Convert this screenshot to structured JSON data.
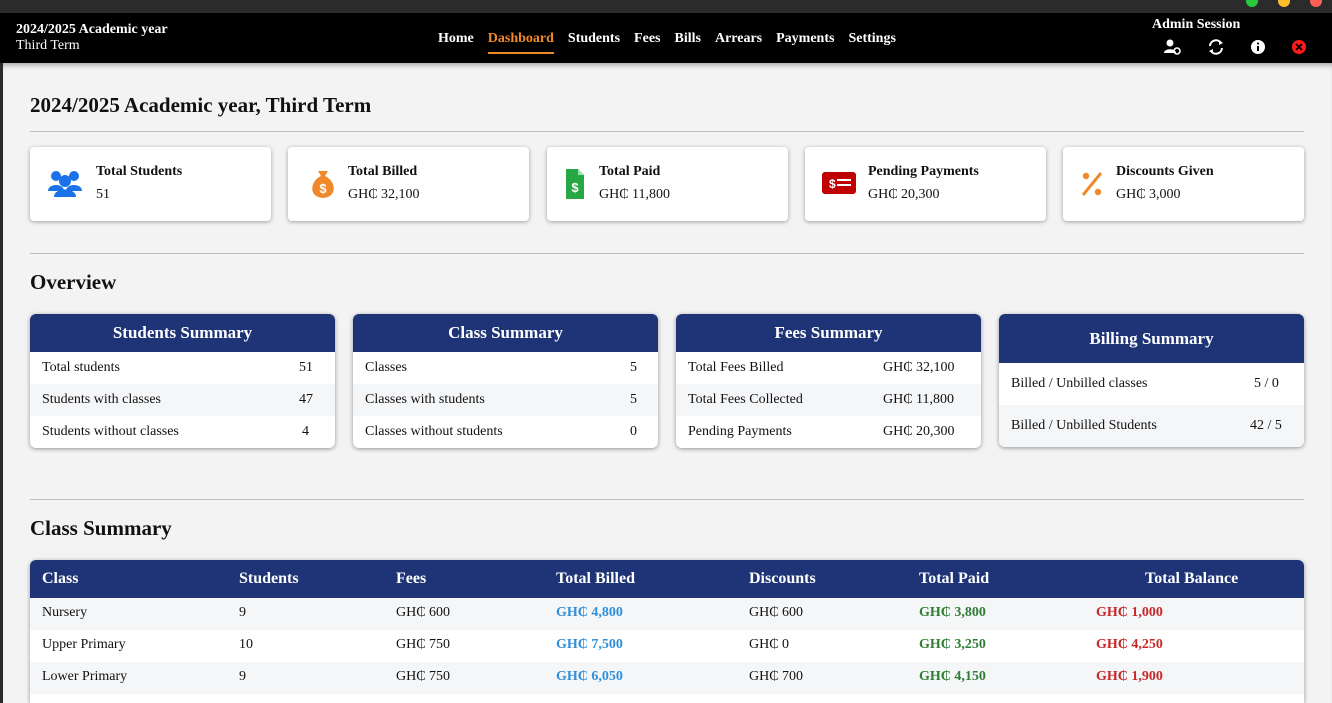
{
  "colors": {
    "nav_bg": "#000000",
    "accent_active": "#f0892a",
    "card_header": "#1f3476",
    "billed": "#2f8fd8",
    "paid": "#2e7d32",
    "balance": "#c62828"
  },
  "nav": {
    "title_line1": "2024/2025 Academic year",
    "title_line2": "Third Term",
    "links": [
      "Home",
      "Dashboard",
      "Students",
      "Fees",
      "Bills",
      "Arrears",
      "Payments",
      "Settings"
    ],
    "active": "Dashboard",
    "session_label": "Admin Session",
    "icons": [
      "user-settings-icon",
      "refresh-icon",
      "info-icon",
      "close-session-icon"
    ]
  },
  "page_title": "2024/2025 Academic year, Third Term",
  "stats": [
    {
      "label": "Total Students",
      "value": "51",
      "icon": "users-icon",
      "color": "#1a73e8"
    },
    {
      "label": "Total Billed",
      "value": "GH₵ 32,100",
      "icon": "money-bag-icon",
      "color": "#f0892a"
    },
    {
      "label": "Total Paid",
      "value": "GH₵ 11,800",
      "icon": "invoice-dollar-icon",
      "color": "#28a745"
    },
    {
      "label": "Pending Payments",
      "value": "GH₵ 20,300",
      "icon": "money-bill-icon",
      "color": "#c00000"
    },
    {
      "label": "Discounts Given",
      "value": "GH₵ 3,000",
      "icon": "percent-icon",
      "color": "#f0892a"
    }
  ],
  "overview": {
    "title": "Overview",
    "students_summary": {
      "title": "Students Summary",
      "rows": [
        {
          "label": "Total students",
          "value": "51"
        },
        {
          "label": "Students with classes",
          "value": "47"
        },
        {
          "label": "Students without classes",
          "value": "4"
        }
      ]
    },
    "class_summary": {
      "title": "Class Summary",
      "rows": [
        {
          "label": "Classes",
          "value": "5"
        },
        {
          "label": "Classes with students",
          "value": "5"
        },
        {
          "label": "Classes without students",
          "value": "0"
        }
      ]
    },
    "fees_summary": {
      "title": "Fees Summary",
      "rows": [
        {
          "label": "Total Fees Billed",
          "value": "GH₵ 32,100"
        },
        {
          "label": "Total Fees Collected",
          "value": "GH₵ 11,800"
        },
        {
          "label": "Pending Payments",
          "value": "GH₵ 20,300"
        }
      ]
    },
    "billing_summary": {
      "title": "Billing Summary",
      "rows": [
        {
          "label": "Billed / Unbilled classes",
          "value": "5 / 0"
        },
        {
          "label": "Billed / Unbilled Students",
          "value": "42 / 5"
        }
      ]
    }
  },
  "class_table": {
    "title": "Class Summary",
    "headers": [
      "Class",
      "Students",
      "Fees",
      "Total Billed",
      "Discounts",
      "Total Paid",
      "Total Balance"
    ],
    "rows": [
      [
        "Nursery",
        "9",
        "GH₵ 600",
        "GH₵ 4,800",
        "GH₵ 600",
        "GH₵ 3,800",
        "GH₵ 1,000"
      ],
      [
        "Upper Primary",
        "10",
        "GH₵ 750",
        "GH₵ 7,500",
        "GH₵ 0",
        "GH₵ 3,250",
        "GH₵ 4,250"
      ],
      [
        "Lower Primary",
        "9",
        "GH₵ 750",
        "GH₵ 6,050",
        "GH₵ 700",
        "GH₵ 4,150",
        "GH₵ 1,900"
      ]
    ]
  }
}
